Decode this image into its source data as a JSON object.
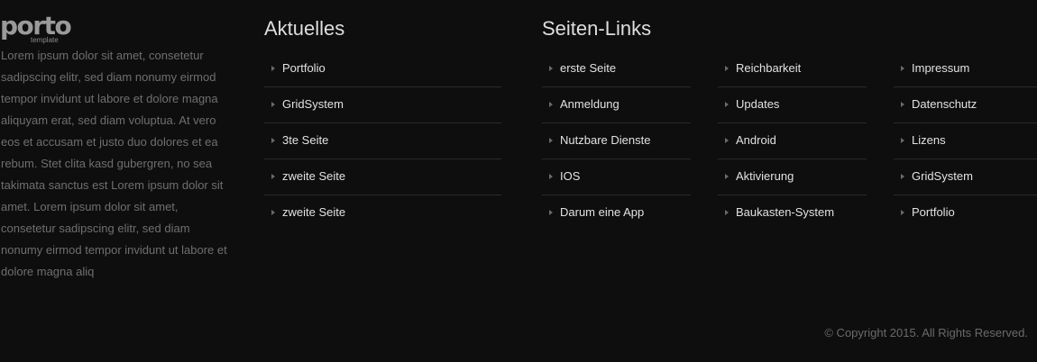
{
  "logo": {
    "word": "porto",
    "sub": "template"
  },
  "about": {
    "text": "Lorem ipsum dolor sit amet, consetetur sadipscing elitr, sed diam nonumy eirmod tempor invidunt ut labore et dolore magna aliquyam erat, sed diam voluptua. At vero eos et accusam et justo duo dolores et ea rebum. Stet clita kasd gubergren, no sea takimata sanctus est Lorem ipsum dolor sit amet. Lorem ipsum dolor sit amet, consetetur sadipscing elitr, sed diam nonumy eirmod tempor invidunt ut labore et dolore magna aliq"
  },
  "aktuelles": {
    "title": "Aktuelles",
    "items": [
      "Portfolio",
      "GridSystem",
      "3te Seite",
      "zweite Seite",
      "zweite Seite"
    ]
  },
  "seiten_links": {
    "title": "Seiten-Links",
    "col1": [
      "erste Seite",
      "Anmeldung",
      "Nutzbare Dienste",
      "IOS",
      "Darum eine App"
    ],
    "col2": [
      "Reichbarkeit",
      "Updates",
      "Android",
      "Aktivierung",
      "Baukasten-System"
    ],
    "col3": [
      "Impressum",
      "Datenschutz",
      "Lizens",
      "GridSystem",
      "Portfolio"
    ]
  },
  "copyright": "© Copyright 2015. All Rights Reserved.",
  "icons": {
    "list_bullet": "caret-right-icon"
  },
  "colors": {
    "background": "#0e0e0e",
    "link": "#e2e2e2",
    "muted": "#6f6f6f",
    "divider": "#2a2a2a"
  }
}
